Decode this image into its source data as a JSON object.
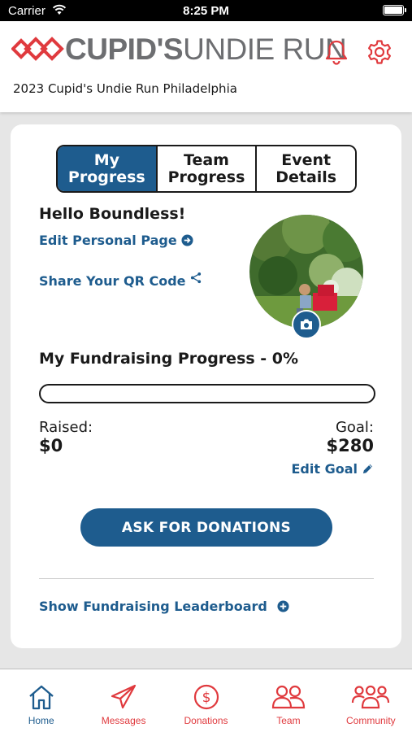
{
  "status_bar": {
    "carrier": "Carrier",
    "time": "8:25 PM"
  },
  "header": {
    "logo": {
      "word1": "CUPID'S",
      "word2": "UNDIE RUN",
      "mark_icon": "double-heart-logo"
    },
    "event_name": "2023 Cupid's Undie Run Philadelphia",
    "icons": [
      "bell-icon",
      "gear-icon"
    ]
  },
  "tabs": [
    {
      "label": "My\nProgress",
      "active": true
    },
    {
      "label": "Team\nProgress",
      "active": false
    },
    {
      "label": "Event\nDetails",
      "active": false
    }
  ],
  "profile": {
    "greeting": "Hello Boundless!",
    "edit_page_label": "Edit Personal Page",
    "share_qr_label": "Share Your QR Code"
  },
  "progress": {
    "title": "My Fundraising Progress - 0%",
    "percent": 0,
    "raised_label": "Raised:",
    "raised_value": "$0",
    "goal_label": "Goal:",
    "goal_value": "$280",
    "edit_goal_label": "Edit Goal"
  },
  "actions": {
    "ask_label": "ASK FOR DONATIONS",
    "leaderboard_label": "Show Fundraising Leaderboard"
  },
  "bottom_nav": [
    {
      "label": "Home",
      "icon": "home-icon",
      "active": true
    },
    {
      "label": "Messages",
      "icon": "paper-plane-icon",
      "active": false
    },
    {
      "label": "Donations",
      "icon": "dollar-circle-icon",
      "active": false
    },
    {
      "label": "Team",
      "icon": "team-icon",
      "active": false
    },
    {
      "label": "Community",
      "icon": "community-icon",
      "active": false
    }
  ],
  "colors": {
    "primary_blue": "#1e5c8e",
    "brand_red": "#e03a3e",
    "logo_gray": "#6d6e71",
    "nav_inactive": "#e03a3e"
  }
}
